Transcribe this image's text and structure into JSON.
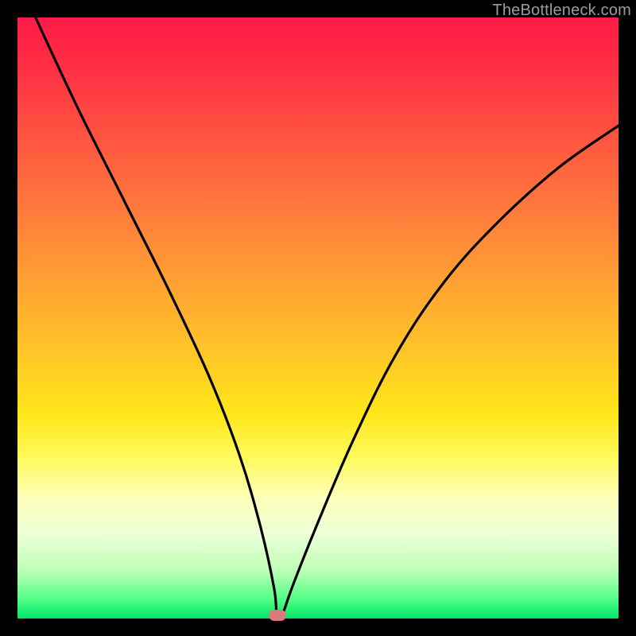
{
  "watermark": "TheBottleneck.com",
  "chart_data": {
    "type": "line",
    "title": "",
    "xlabel": "",
    "ylabel": "",
    "xlim": [
      0,
      100
    ],
    "ylim": [
      0,
      100
    ],
    "grid": false,
    "legend": false,
    "series": [
      {
        "name": "bottleneck-curve",
        "x": [
          3,
          10,
          18,
          25,
          32,
          37,
          40.5,
          42.7,
          43.2,
          44,
          46,
          50,
          56,
          63,
          71,
          80,
          90,
          100
        ],
        "values": [
          100,
          85,
          69,
          55,
          40,
          27,
          15,
          5,
          0,
          0.5,
          6,
          16,
          30,
          44,
          56,
          66,
          75,
          82
        ]
      }
    ],
    "marker": {
      "x": 43.2,
      "y": 0,
      "color": "#d77b7b"
    },
    "background_gradient": {
      "stops": [
        {
          "pos": 0,
          "color": "#ff1a46"
        },
        {
          "pos": 20,
          "color": "#ff5440"
        },
        {
          "pos": 44,
          "color": "#ffa133"
        },
        {
          "pos": 66,
          "color": "#ffe61a"
        },
        {
          "pos": 86,
          "color": "#edffd7"
        },
        {
          "pos": 100,
          "color": "#00e46a"
        }
      ]
    }
  }
}
